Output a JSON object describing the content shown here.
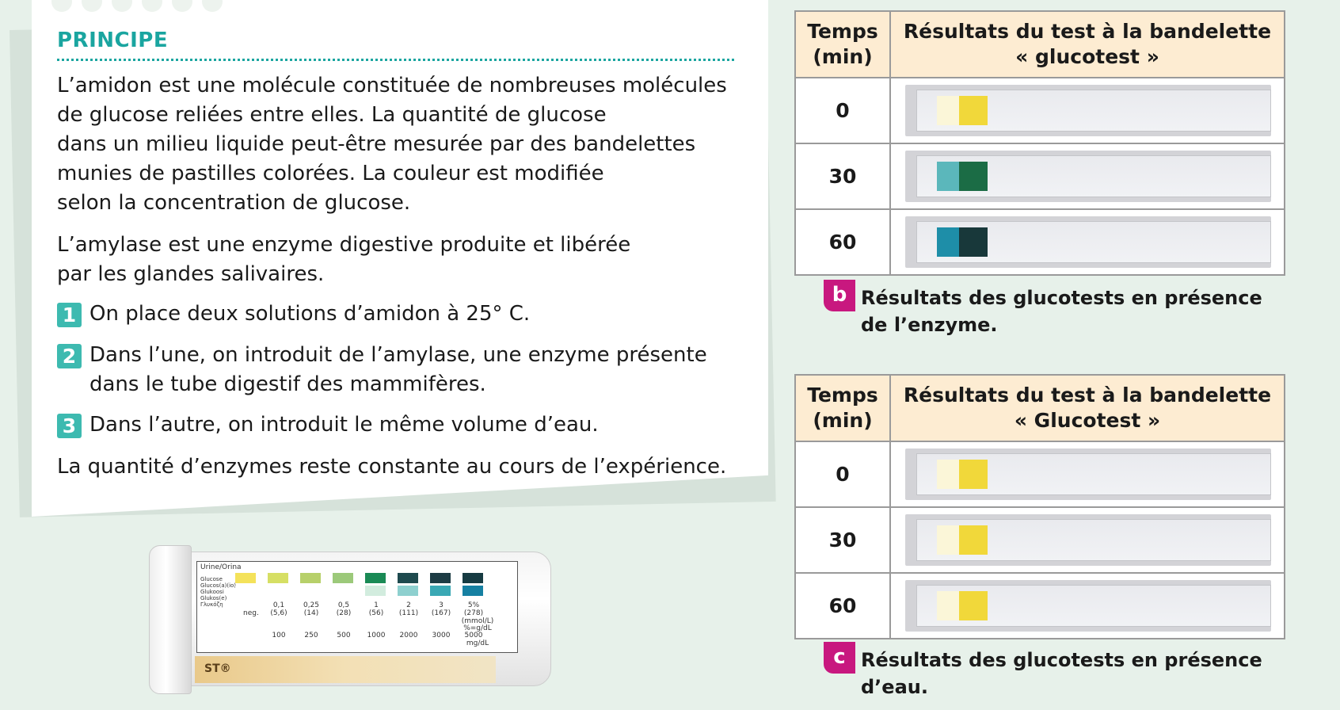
{
  "principe": {
    "title": "PRINCIPE",
    "paragraph1": [
      "L’amidon est une molécule constituée de nombreuses molécules",
      "de glucose reliées entre elles. La quantité de glucose",
      "dans un milieu liquide peut-être mesurée par des bandelettes",
      "munies de pastilles colorées. La couleur est modifiée",
      "selon la concentration de glucose."
    ],
    "paragraph2": [
      "L’amylase est une enzyme digestive produite et libérée",
      "par les glandes salivaires."
    ],
    "steps": [
      {
        "num": "1",
        "lines": [
          "On place deux solutions d’amidon à 25° C."
        ]
      },
      {
        "num": "2",
        "lines": [
          "Dans l’une, on introduit de l’amylase, une enzyme présente",
          "dans le tube digestif des mammifères."
        ]
      },
      {
        "num": "3",
        "lines": [
          "Dans l’autre, on introduit le même volume d’eau."
        ]
      }
    ],
    "conclusion": "La quantité d’enzymes reste constante au cours de l’expérience."
  },
  "tube_label": {
    "header": "Urine/Orina",
    "names": [
      "Glucose",
      "Glucos(a)(io)",
      "Glukoosi",
      "Glukos(e)",
      "Γλυκόζη"
    ],
    "neg": "neg.",
    "mmol": [
      "0,1",
      "0,25",
      "0,5",
      "1",
      "2",
      "3",
      "5%"
    ],
    "mmol_sub": [
      "(5,6)",
      "(14)",
      "(28)",
      "(56)",
      "(111)",
      "(167)",
      "(278)"
    ],
    "units": "(mmol/L)",
    "percent_unit": "%=g/dL",
    "mgdl": [
      "100",
      "250",
      "500",
      "1000",
      "2000",
      "3000",
      "5000"
    ],
    "mgdl_unit": "mg/dL",
    "top_colors": [
      "#f4e25a",
      "#d6df64",
      "#b7d06a",
      "#9cc97a",
      "#1a8a55",
      "#1e4a4e",
      "#1d3c44",
      "#173b42"
    ],
    "bottom_colors": [
      "#ffffff",
      "#ffffff",
      "#ffffff",
      "#ffffff",
      "#d2ecde",
      "#8ed0cf",
      "#3aa8b4",
      "#1680a2"
    ]
  },
  "table_b": {
    "col_time": [
      "Temps",
      "(min)"
    ],
    "col_result": [
      "Résultats du test à la bandelette",
      "« glucotest »"
    ],
    "rows": [
      {
        "time": "0",
        "pad1": "#fbf6d8",
        "pad2": "#f1d83a"
      },
      {
        "time": "30",
        "pad1": "#5bb7bb",
        "pad2": "#1b6c45"
      },
      {
        "time": "60",
        "pad1": "#1e8ea8",
        "pad2": "#18383a"
      }
    ],
    "caption_letter": "b",
    "caption": [
      "Résultats des glucotests en présence",
      "de l’enzyme."
    ]
  },
  "table_c": {
    "col_time": [
      "Temps",
      "(min)"
    ],
    "col_result": [
      "Résultats du test à la bandelette",
      "« Glucotest »"
    ],
    "rows": [
      {
        "time": "0",
        "pad1": "#fbf6d8",
        "pad2": "#f1d83a"
      },
      {
        "time": "30",
        "pad1": "#fbf6d8",
        "pad2": "#f1d83a"
      },
      {
        "time": "60",
        "pad1": "#fbf6d8",
        "pad2": "#f1d83a"
      }
    ],
    "caption_letter": "c",
    "caption": [
      "Résultats des glucotests en présence",
      "d’eau."
    ]
  }
}
